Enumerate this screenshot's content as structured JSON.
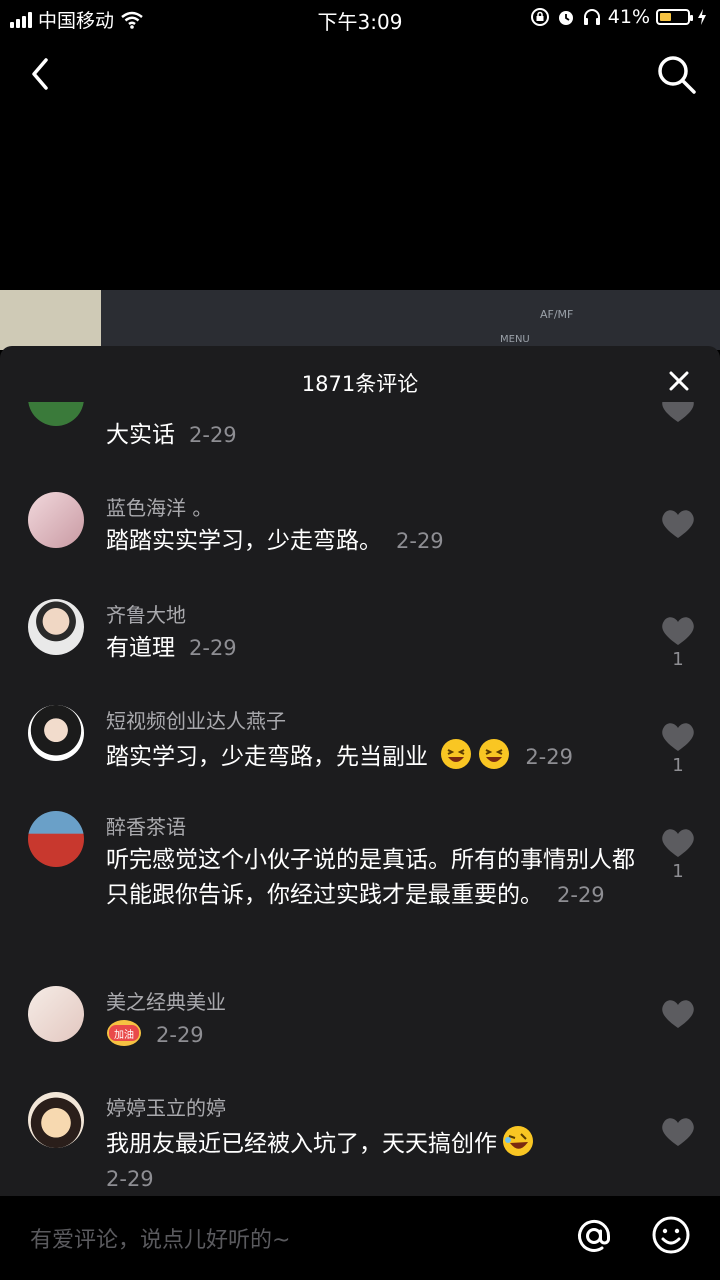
{
  "status_bar": {
    "carrier": "中国移动",
    "time": "下午3:09",
    "battery_percent": "41%",
    "battery_level": 0.41
  },
  "nav": {
    "back_icon": "chevron-left-icon",
    "search_icon": "search-icon"
  },
  "sheet": {
    "title": "1871条评论",
    "close_icon": "close-icon"
  },
  "comments": [
    {
      "name": "",
      "text": "大实话",
      "date": "2-29",
      "likes": ""
    },
    {
      "name": "蓝色海洋 。",
      "text": "踏踏实实学习，少走弯路。",
      "date": "2-29",
      "likes": ""
    },
    {
      "name": "齐鲁大地",
      "text": "有道理",
      "date": "2-29",
      "likes": "1"
    },
    {
      "name": "短视频创业达人燕子",
      "text": "踏实学习，少走弯路，先当副业",
      "date": "2-29",
      "likes": "1"
    },
    {
      "name": "醉香茶语",
      "text": "听完感觉这个小伙子说的是真话。所有的事情别人都只能跟你告诉，你经过实践才是最重要的。",
      "date": "2-29",
      "likes": "1"
    },
    {
      "name": "美之经典美业",
      "text": "",
      "date": "2-29",
      "likes": "",
      "sticker": "加油"
    },
    {
      "name": "婷婷玉立的婷",
      "text": "我朋友最近已经被入坑了，天天搞创作",
      "date": "2-29",
      "likes": ""
    }
  ],
  "input": {
    "placeholder": "有爱评论，说点儿好听的~",
    "at_icon": "at-icon",
    "emoji_icon": "smiley-icon"
  },
  "colors": {
    "background": "#000000",
    "sheet": "#1c1c1e",
    "name_text": "#a9a9ad",
    "date_text": "#8e8e93",
    "battery_fill": "#f5c242"
  }
}
